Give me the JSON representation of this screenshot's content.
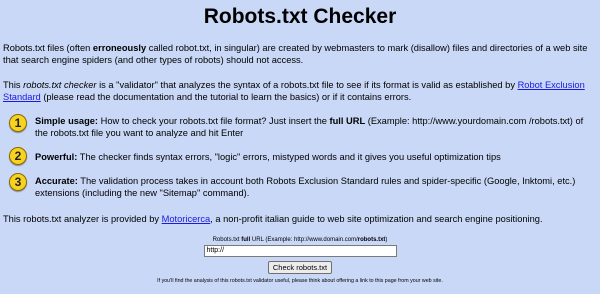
{
  "title": "Robots.txt Checker",
  "intro1": {
    "a": "Robots.txt files (often ",
    "b": "erroneously",
    "c": " called robot.txt, in singular) are created by webmasters to mark (disallow) files and directories of a web site that search engine spiders (and other types of robots) should not access."
  },
  "intro2": {
    "a": "This ",
    "b": "robots.txt checker",
    "c": " is a \"validator\" that analyzes the syntax of a robots.txt file to see if its format is valid as established by ",
    "link": "Robot Exclusion Standard",
    "d": " (please read the documentation and the tutorial to learn the basics) or if it contains errors."
  },
  "features": [
    {
      "num": "1",
      "head": "Simple usage:",
      "a": " How to check your robots.txt file format? Just insert the ",
      "b": "full URL",
      "c": " (Example: http://www.yourdomain.com /robots.txt) of the robots.txt file you want to analyze and hit Enter"
    },
    {
      "num": "2",
      "head": "Powerful:",
      "a": " The checker finds syntax errors, \"logic\" errors, mistyped words and it gives you useful optimization tips"
    },
    {
      "num": "3",
      "head": "Accurate:",
      "a": " The validation process takes in account both Robots Exclusion Standard rules and spider-specific (Google, Inktomi, etc.) extensions (including the new \"Sitemap\" command)."
    }
  ],
  "provided": {
    "a": "This robots.txt analyzer is provided by ",
    "link": "Motoricerca",
    "b": ", a non-profit italian guide to web site optimization and search engine positioning."
  },
  "form": {
    "label_a": "Robots.txt ",
    "label_b": "full",
    "label_c": " URL (Example: http://www.domain.com/",
    "label_d": "robots.txt",
    "label_e": ")",
    "url_value": "http://",
    "button": "Check robots.txt"
  },
  "footnote": "If you'll find the analysis of this robots.txt validator useful, please think about offering a link to this page from your web site.",
  "colors": {
    "background": "#c9d8f7",
    "link": "#1a1ae0",
    "badge": "#f7d21f"
  }
}
